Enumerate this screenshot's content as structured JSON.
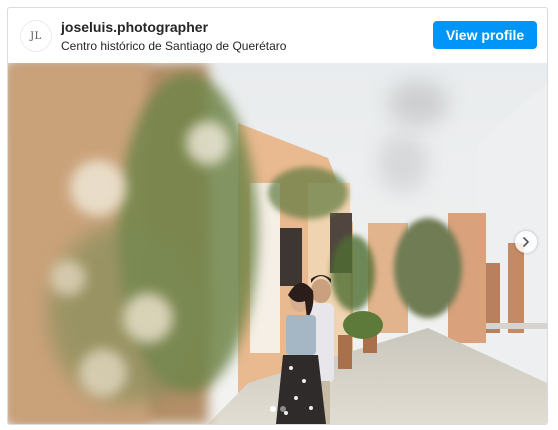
{
  "post": {
    "avatar_text": "JL",
    "username": "joseluis.photographer",
    "location": "Centro histórico de Santiago de Querétaro",
    "view_profile_label": "View profile",
    "accent_color": "#0095f6"
  },
  "photo": {
    "description_icon": "couple-street-photo",
    "carousel": {
      "dot_count": 2,
      "active_index": 0,
      "next_icon": "chevron-right-icon"
    }
  }
}
